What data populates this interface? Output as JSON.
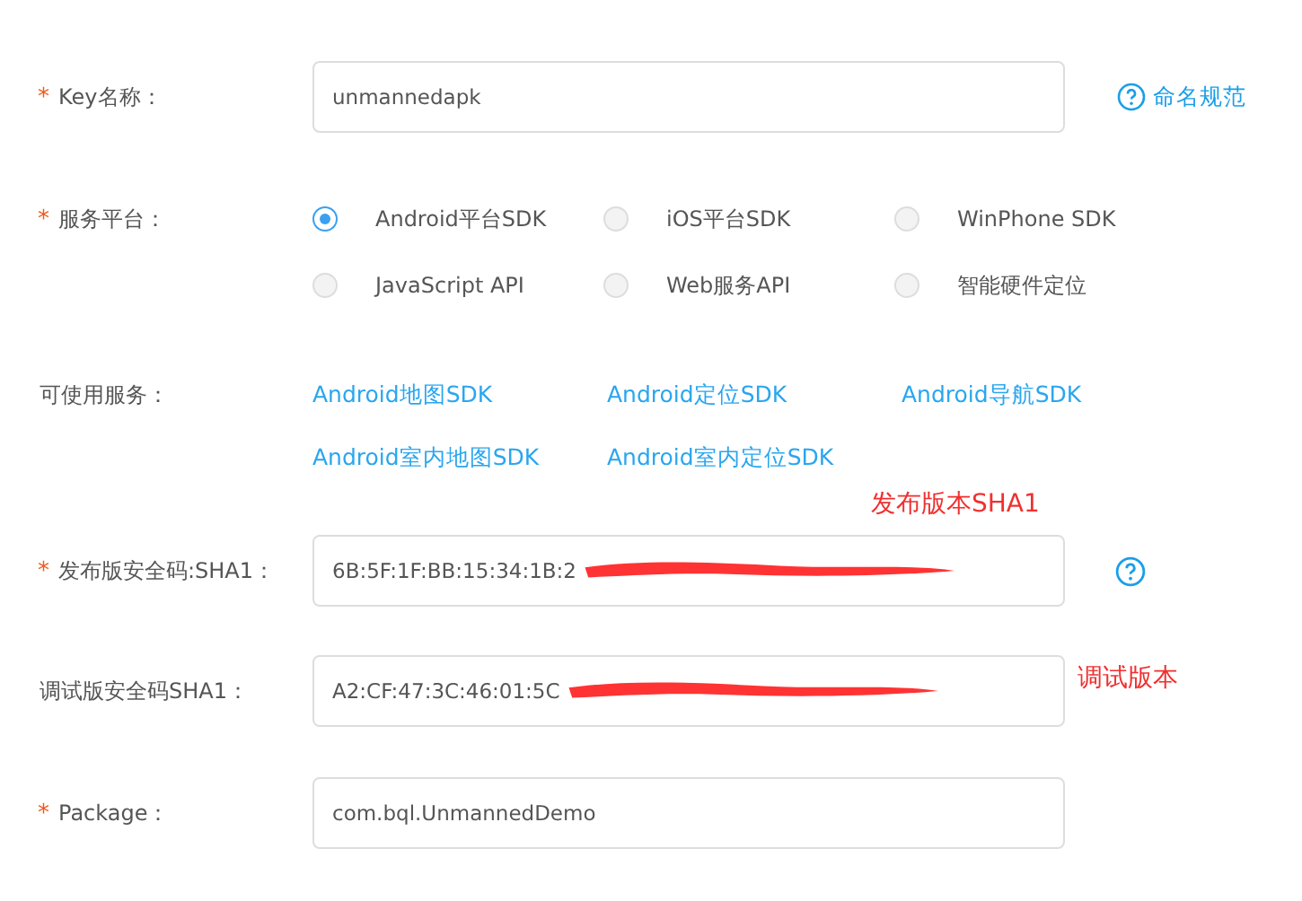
{
  "form": [
    {
      "kind": "input",
      "required_mark": "*",
      "label": "Key名称：",
      "value": "unmannedapk",
      "help": {
        "kind": "link",
        "text": "命名规范"
      }
    },
    {
      "kind": "radios",
      "required_mark": "*",
      "label": "服务平台：",
      "options": [
        {
          "label": "Android平台SDK",
          "selected": true
        },
        {
          "label": "iOS平台SDK",
          "selected": false
        },
        {
          "label": "WinPhone SDK",
          "selected": false
        },
        {
          "label": "JavaScript API",
          "selected": false
        },
        {
          "label": "Web服务API",
          "selected": false
        },
        {
          "label": "智能硬件定位",
          "selected": false
        }
      ]
    },
    {
      "kind": "links",
      "label": "可使用服务：",
      "links": [
        "Android地图SDK",
        "Android定位SDK",
        "Android导航SDK",
        "Android室内地图SDK",
        "Android室内定位SDK"
      ]
    },
    {
      "kind": "input",
      "required_mark": "*",
      "label": "发布版安全码:SHA1：",
      "value": "6B:5F:1F:BB:15:34:1B:2",
      "redacted": true,
      "help": {
        "kind": "icon"
      },
      "annotation": {
        "kind": "above",
        "text": "发布版本SHA1"
      }
    },
    {
      "kind": "input",
      "label": "调试版安全码SHA1：",
      "value": "A2:CF:47:3C:46:01:5C",
      "redacted": true,
      "annotation": {
        "kind": "right",
        "text": "调试版本"
      }
    },
    {
      "kind": "input",
      "required_mark": "*",
      "label": "Package：",
      "value": "com.bql.UnmannedDemo"
    }
  ]
}
